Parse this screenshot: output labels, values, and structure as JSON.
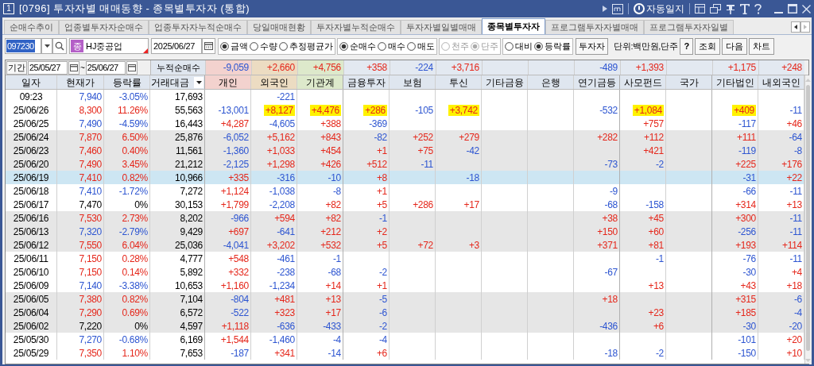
{
  "window": {
    "number": "1",
    "title": "[0796] 투자자별 매매동향 - 종목별투자자 (통합)",
    "auto_journal": "자동일지"
  },
  "tabs": [
    {
      "label": "순매수추이",
      "selected": false
    },
    {
      "label": "업종별투자자순매수",
      "selected": false
    },
    {
      "label": "업종투자자누적순매수",
      "selected": false
    },
    {
      "label": "당일매매현황",
      "selected": false
    },
    {
      "label": "투자자별누적순매수",
      "selected": false
    },
    {
      "label": "투자자별일별매매",
      "selected": false
    },
    {
      "label": "종목별투자자",
      "selected": true
    },
    {
      "label": "프로그램투자자별매매",
      "selected": false
    },
    {
      "label": "프로그램투자자일별",
      "selected": false
    }
  ],
  "toolbar": {
    "stock_code": "097230",
    "market_badge": "종",
    "stock_name": "HJ중공업",
    "date": "2025/06/27",
    "radio_groups": [
      {
        "options": [
          {
            "label": "금액",
            "selected": true,
            "disabled": false
          },
          {
            "label": "수량",
            "selected": false,
            "disabled": false
          },
          {
            "label": "추정평균가",
            "selected": false,
            "disabled": false
          }
        ]
      },
      {
        "options": [
          {
            "label": "순매수",
            "selected": true,
            "disabled": false
          },
          {
            "label": "매수",
            "selected": false,
            "disabled": false
          },
          {
            "label": "매도",
            "selected": false,
            "disabled": false
          }
        ]
      },
      {
        "options": [
          {
            "label": "천주",
            "selected": false,
            "disabled": true
          },
          {
            "label": "단주",
            "selected": true,
            "disabled": true
          }
        ]
      },
      {
        "options": [
          {
            "label": "대비",
            "selected": false,
            "disabled": false
          },
          {
            "label": "등락률",
            "selected": true,
            "disabled": false
          }
        ]
      }
    ],
    "investor_button": "투자자",
    "unit": "단위:백만원,단주",
    "buttons": [
      "?",
      "조회",
      "다음",
      "차트"
    ]
  },
  "period": {
    "label": "기간",
    "from": "25/05/27",
    "separator": "~",
    "to": "25/06/27",
    "cumulative_label": "누적순매수"
  },
  "table": {
    "totals": [
      {
        "text": "-9,059"
      },
      {
        "text": "+2,660"
      },
      {
        "text": "+4,756"
      },
      {
        "text": "+358"
      },
      {
        "text": "-224"
      },
      {
        "text": "+3,716"
      },
      {
        "blank": true
      },
      {
        "blank": true
      },
      {
        "text": "-489"
      },
      {
        "text": "+1,393"
      },
      {
        "blank": true
      },
      {
        "text": "+1,175"
      },
      {
        "text": "+248"
      }
    ],
    "columns": [
      "일자",
      "현재가",
      "등락률",
      "거래대금",
      "개인",
      "외국인",
      "기관계",
      "금융투자",
      "보험",
      "투신",
      "기타금융",
      "은행",
      "연기금등",
      "사모펀드",
      "국가",
      "기타법인",
      "내외국인"
    ],
    "rows": [
      {
        "shaded": false,
        "selected": false,
        "cells": [
          "09:23",
          "7,940",
          "-3.05%",
          "17,693",
          null,
          "-221",
          null,
          null,
          null,
          null,
          null,
          null,
          null,
          null,
          null,
          null,
          null
        ]
      },
      {
        "shaded": false,
        "selected": false,
        "cells": [
          "25/06/26",
          "8,300",
          "11.26%",
          "55,563",
          "-13,001",
          {
            "text": "+8,127",
            "highlighted": true
          },
          {
            "text": "+4,476",
            "highlighted": true
          },
          {
            "text": "+286",
            "highlighted": true
          },
          "-105",
          {
            "text": "+3,742",
            "highlighted": true
          },
          null,
          null,
          "-532",
          {
            "text": "+1,084",
            "highlighted": true
          },
          null,
          {
            "text": "+409",
            "highlighted": true
          },
          "-11"
        ]
      },
      {
        "shaded": false,
        "selected": false,
        "cells": [
          "25/06/25",
          "7,490",
          "-4.59%",
          "16,443",
          "+4,287",
          "-4,605",
          "+388",
          "-369",
          null,
          null,
          null,
          null,
          null,
          "+757",
          null,
          "-117",
          "+46"
        ]
      },
      {
        "shaded": true,
        "selected": false,
        "cells": [
          "25/06/24",
          "7,870",
          "6.50%",
          "25,876",
          "-6,052",
          "+5,162",
          "+843",
          "-82",
          "+252",
          "+279",
          null,
          null,
          "+282",
          "+112",
          null,
          "+111",
          "-64"
        ]
      },
      {
        "shaded": true,
        "selected": false,
        "cells": [
          "25/06/23",
          "7,460",
          "0.40%",
          "11,561",
          "-1,360",
          "+1,033",
          "+454",
          "+1",
          "+75",
          "-42",
          null,
          null,
          null,
          "+421",
          null,
          "-119",
          "-8"
        ]
      },
      {
        "shaded": true,
        "selected": false,
        "cells": [
          "25/06/20",
          "7,490",
          "3.45%",
          "21,212",
          "-2,125",
          "+1,298",
          "+426",
          "+512",
          "-11",
          null,
          null,
          null,
          "-73",
          "-2",
          null,
          "+225",
          "+176"
        ]
      },
      {
        "shaded": false,
        "selected": true,
        "cells": [
          "25/06/19",
          "7,410",
          "0.82%",
          "10,966",
          "+335",
          "-316",
          "-10",
          "+8",
          null,
          "-18",
          null,
          null,
          null,
          null,
          null,
          "-31",
          "+22"
        ]
      },
      {
        "shaded": false,
        "selected": false,
        "cells": [
          "25/06/18",
          "7,410",
          "-1.72%",
          "7,272",
          "+1,124",
          "-1,038",
          "-8",
          "+1",
          null,
          null,
          null,
          null,
          "-9",
          null,
          null,
          "-66",
          "-11"
        ]
      },
      {
        "shaded": false,
        "selected": false,
        "cells": [
          "25/06/17",
          "7,470",
          "0%",
          "30,153",
          "+1,799",
          "-2,208",
          "+82",
          "+5",
          "+286",
          "+17",
          null,
          null,
          "-68",
          "-158",
          null,
          "+314",
          "+13"
        ]
      },
      {
        "shaded": true,
        "selected": false,
        "cells": [
          "25/06/16",
          "7,530",
          "2.73%",
          "8,202",
          "-966",
          "+594",
          "+82",
          "-1",
          null,
          null,
          null,
          null,
          "+38",
          "+45",
          null,
          "+300",
          "-11"
        ]
      },
      {
        "shaded": true,
        "selected": false,
        "cells": [
          "25/06/13",
          "7,320",
          "-2.79%",
          "9,429",
          "+697",
          "-641",
          "+212",
          "+2",
          null,
          null,
          null,
          null,
          "+150",
          "+60",
          null,
          "-256",
          "-11"
        ]
      },
      {
        "shaded": true,
        "selected": false,
        "cells": [
          "25/06/12",
          "7,550",
          "6.04%",
          "25,036",
          "-4,041",
          "+3,202",
          "+532",
          "+5",
          "+72",
          "+3",
          null,
          null,
          "+371",
          "+81",
          null,
          "+193",
          "+114"
        ]
      },
      {
        "shaded": false,
        "selected": false,
        "cells": [
          "25/06/11",
          "7,150",
          "0.28%",
          "4,777",
          "+548",
          "-461",
          "-1",
          null,
          null,
          null,
          null,
          null,
          null,
          "-1",
          null,
          "-76",
          "-11"
        ]
      },
      {
        "shaded": false,
        "selected": false,
        "cells": [
          "25/06/10",
          "7,150",
          "0.14%",
          "5,892",
          "+332",
          "-238",
          "-68",
          "-2",
          null,
          null,
          null,
          null,
          "-67",
          null,
          null,
          "-30",
          "+4"
        ]
      },
      {
        "shaded": false,
        "selected": false,
        "cells": [
          "25/06/09",
          "7,140",
          "-3.38%",
          "10,653",
          "+1,160",
          "-1,234",
          "+14",
          "+1",
          null,
          null,
          null,
          null,
          null,
          "+13",
          null,
          "+43",
          "+18"
        ]
      },
      {
        "shaded": true,
        "selected": false,
        "cells": [
          "25/06/05",
          "7,380",
          "0.82%",
          "7,104",
          "-804",
          "+481",
          "+13",
          "-5",
          null,
          null,
          null,
          null,
          "+18",
          null,
          null,
          "+315",
          "-6"
        ]
      },
      {
        "shaded": true,
        "selected": false,
        "cells": [
          "25/06/04",
          "7,290",
          "0.69%",
          "6,572",
          "-522",
          "+323",
          "+17",
          "-6",
          null,
          null,
          null,
          null,
          null,
          "+23",
          null,
          "+185",
          "-4"
        ]
      },
      {
        "shaded": true,
        "selected": false,
        "cells": [
          "25/06/02",
          "7,220",
          "0%",
          "4,597",
          "+1,118",
          "-636",
          "-433",
          "-2",
          null,
          null,
          null,
          null,
          "-436",
          "+6",
          null,
          "-30",
          "-20"
        ]
      },
      {
        "shaded": false,
        "selected": false,
        "cells": [
          "25/05/30",
          "7,270",
          "-0.68%",
          "6,169",
          "+1,544",
          "-1,460",
          "-4",
          "-4",
          null,
          null,
          null,
          null,
          null,
          null,
          null,
          "-101",
          "+20"
        ]
      },
      {
        "shaded": false,
        "selected": false,
        "cells": [
          "25/05/29",
          "7,350",
          "1.10%",
          "7,653",
          "-187",
          "+341",
          "-14",
          "+6",
          null,
          null,
          null,
          null,
          "-18",
          "-2",
          null,
          "-150",
          "+10"
        ]
      }
    ]
  }
}
